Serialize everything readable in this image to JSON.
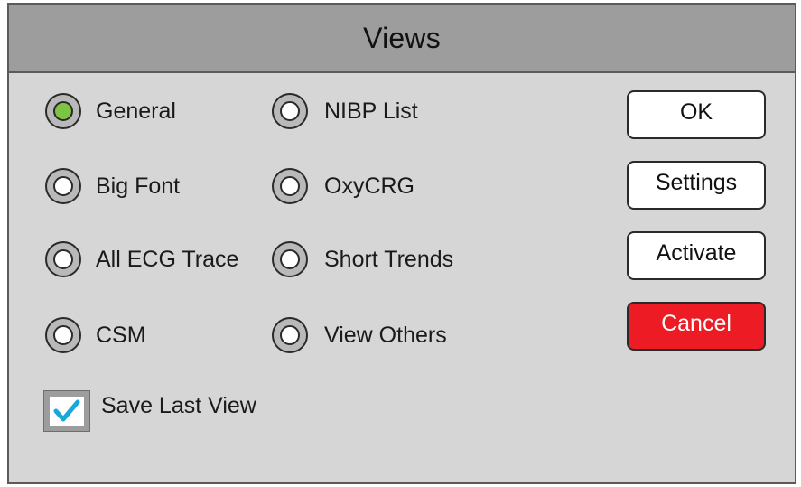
{
  "dialog": {
    "title": "Views"
  },
  "views": [
    {
      "label": "General",
      "selected": true
    },
    {
      "label": "Big Font",
      "selected": false
    },
    {
      "label": "All ECG Trace",
      "selected": false
    },
    {
      "label": "CSM",
      "selected": false
    },
    {
      "label": "NIBP List",
      "selected": false
    },
    {
      "label": "OxyCRG",
      "selected": false
    },
    {
      "label": "Short Trends",
      "selected": false
    },
    {
      "label": "View Others",
      "selected": false
    }
  ],
  "buttons": {
    "ok": "OK",
    "settings": "Settings",
    "activate": "Activate",
    "cancel": "Cancel"
  },
  "save_last_view": {
    "label": "Save Last View",
    "checked": true
  },
  "colors": {
    "selected_radio": "#7dc442",
    "cancel_button": "#ed1c24",
    "check_mark": "#1aa6d9",
    "titlebar": "#9d9d9e",
    "panel": "#d6d6d6"
  }
}
